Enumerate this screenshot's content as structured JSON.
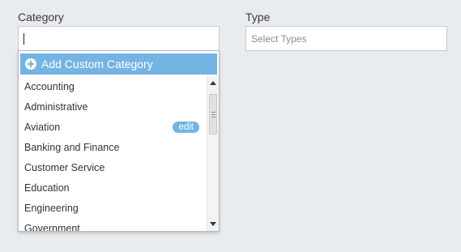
{
  "category": {
    "label": "Category",
    "value": "",
    "placeholder": ""
  },
  "type": {
    "label": "Type",
    "placeholder": "Select Types"
  },
  "dropdown": {
    "add_custom_label": "Add Custom Category",
    "items": [
      {
        "label": "Accounting"
      },
      {
        "label": "Administrative"
      },
      {
        "label": "Aviation",
        "badge": "edit"
      },
      {
        "label": "Banking and Finance"
      },
      {
        "label": "Customer Service"
      },
      {
        "label": "Education"
      },
      {
        "label": "Engineering"
      },
      {
        "label": "Government"
      }
    ]
  },
  "colors": {
    "accent": "#74b4e3",
    "background": "#e8ecef"
  }
}
